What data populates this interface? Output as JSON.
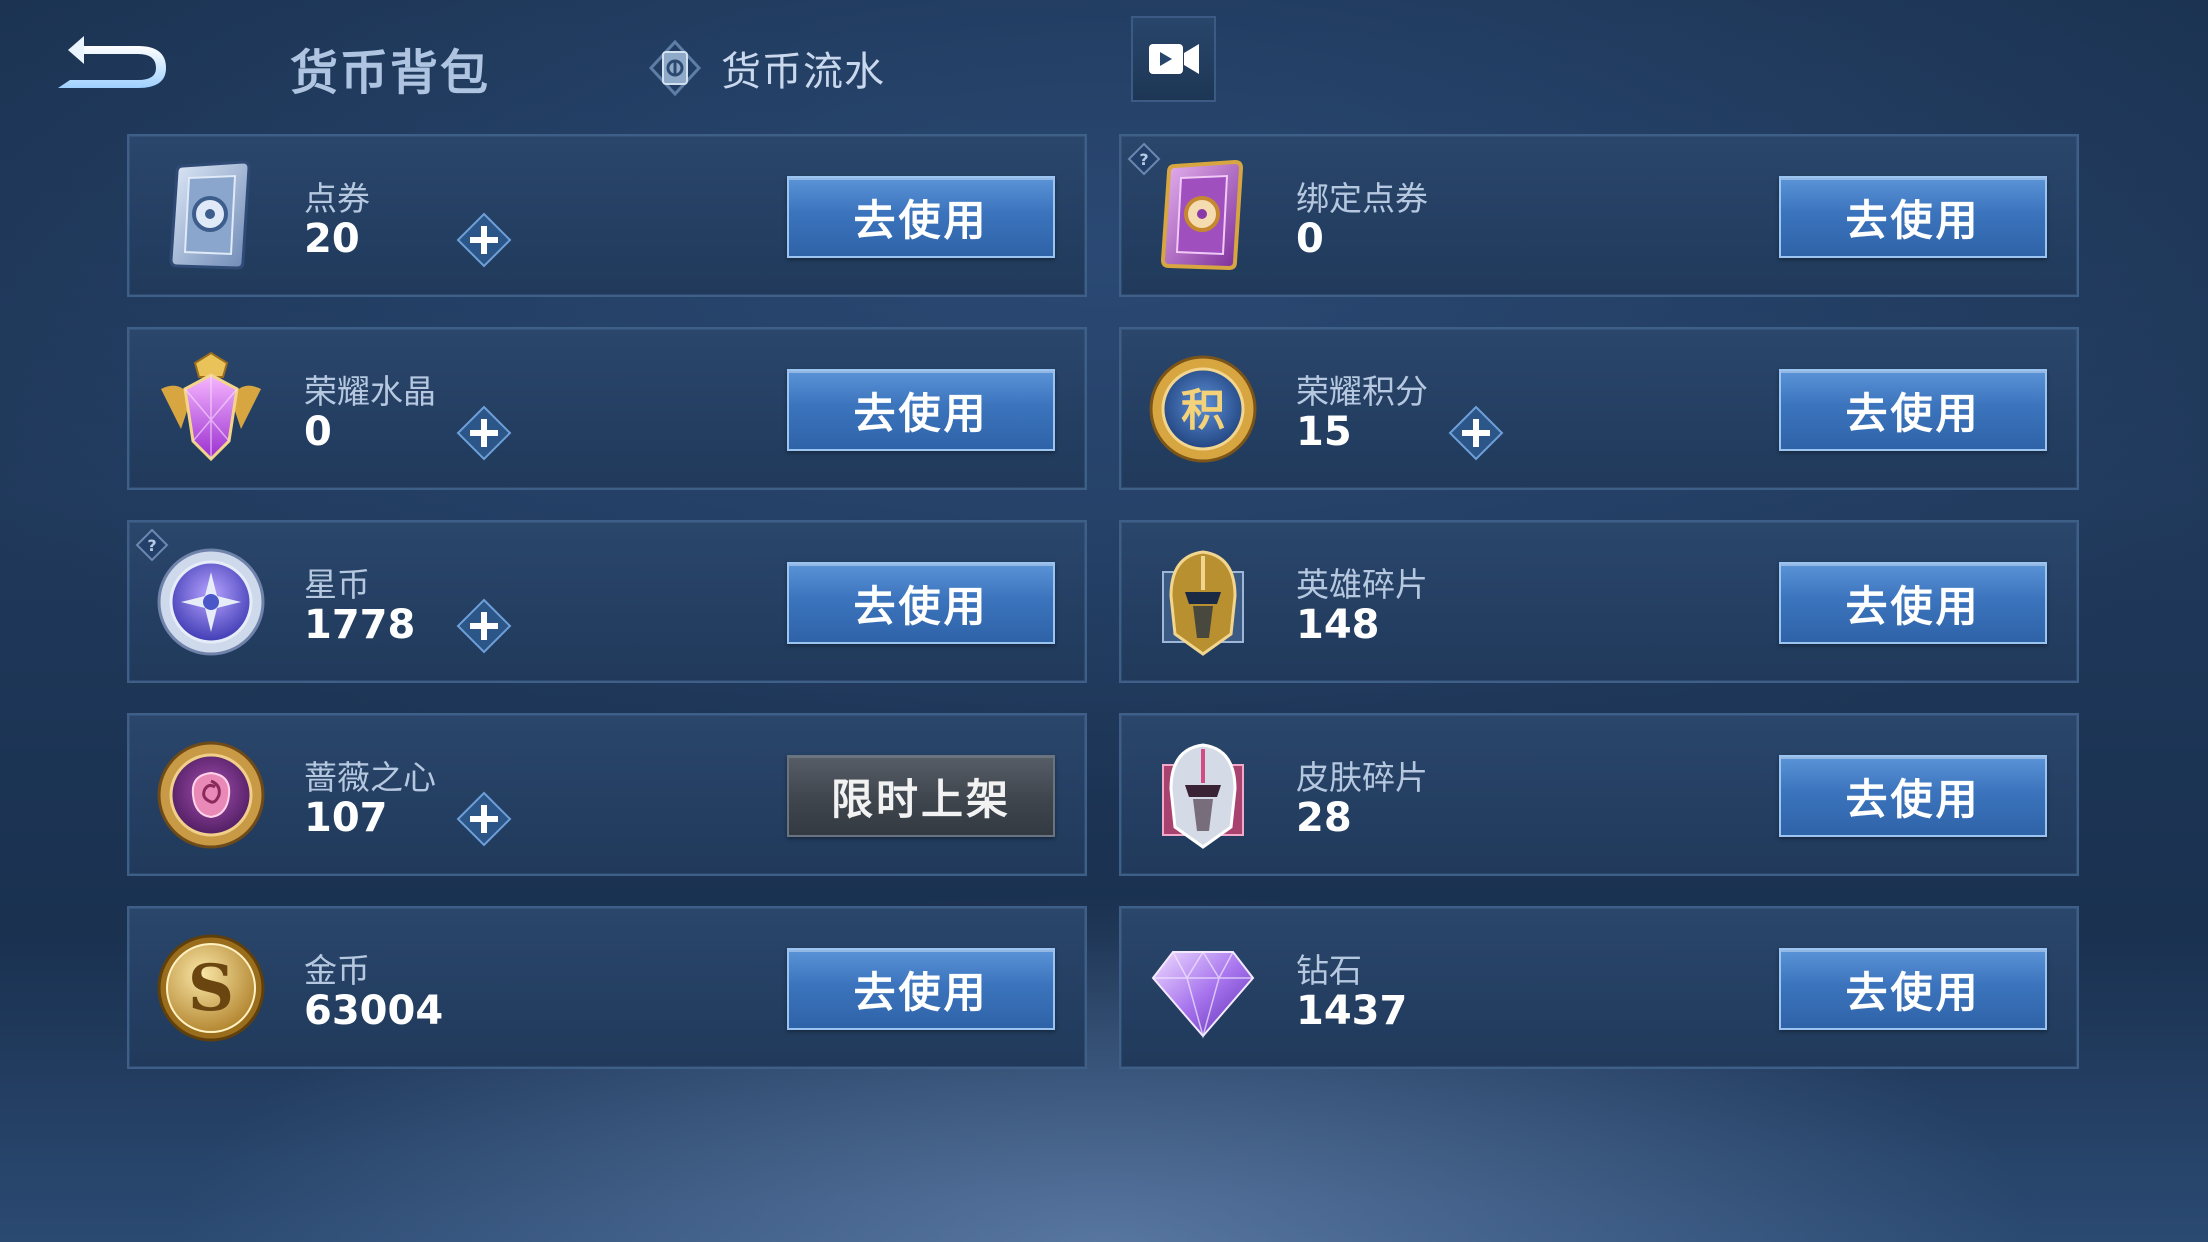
{
  "header": {
    "title": "货币背包",
    "history_label": "货币流水"
  },
  "currencies": [
    {
      "name": "点券",
      "amount": "20",
      "action": "去使用",
      "icon": "coupon-card-icon"
    },
    {
      "name": "绑定点券",
      "amount": "0",
      "action": "去使用",
      "icon": "bound-coupon-card-icon"
    },
    {
      "name": "荣耀水晶",
      "amount": "0",
      "action": "去使用",
      "icon": "glory-crystal-icon"
    },
    {
      "name": "荣耀积分",
      "amount": "15",
      "action": "去使用",
      "icon": "glory-points-medal-icon"
    },
    {
      "name": "星币",
      "amount": "1778",
      "action": "去使用",
      "icon": "star-coin-icon"
    },
    {
      "name": "英雄碎片",
      "amount": "148",
      "action": "去使用",
      "icon": "hero-fragment-helmet-icon"
    },
    {
      "name": "蔷薇之心",
      "amount": "107",
      "action": "限时上架",
      "icon": "rose-heart-coin-icon"
    },
    {
      "name": "皮肤碎片",
      "amount": "28",
      "action": "去使用",
      "icon": "skin-fragment-helmet-icon"
    },
    {
      "name": "金币",
      "amount": "63004",
      "action": "去使用",
      "icon": "gold-coin-icon"
    },
    {
      "name": "钻石",
      "amount": "1437",
      "action": "去使用",
      "icon": "diamond-icon"
    }
  ],
  "colors": {
    "background": "#20395b",
    "card": "#243f62",
    "action_button": "#3b74bd",
    "limited_button": "#3f454d"
  }
}
